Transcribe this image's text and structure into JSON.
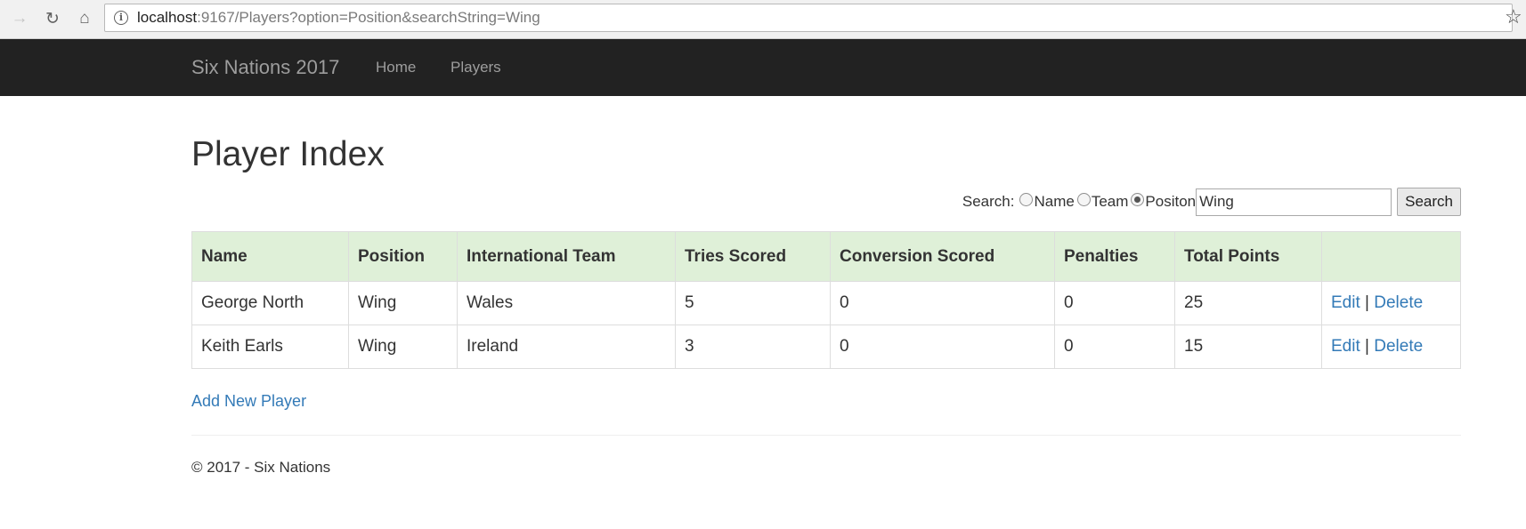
{
  "browser": {
    "url_host": "localhost",
    "url_rest": ":9167/Players?option=Position&searchString=Wing"
  },
  "navbar": {
    "brand": "Six Nations 2017",
    "links": [
      "Home",
      "Players"
    ]
  },
  "page": {
    "title": "Player Index"
  },
  "search": {
    "label": "Search:",
    "options": [
      {
        "label": "Name",
        "checked": false
      },
      {
        "label": "Team",
        "checked": false
      },
      {
        "label": "Positon",
        "checked": true
      }
    ],
    "value": "Wing",
    "button": "Search"
  },
  "table": {
    "headers": [
      "Name",
      "Position",
      "International Team",
      "Tries Scored",
      "Conversion Scored",
      "Penalties",
      "Total Points",
      ""
    ],
    "rows": [
      {
        "name": "George North",
        "position": "Wing",
        "team": "Wales",
        "tries": "5",
        "conversions": "0",
        "penalties": "0",
        "total": "25",
        "edit": "Edit",
        "sep": "|",
        "delete": "Delete"
      },
      {
        "name": "Keith Earls",
        "position": "Wing",
        "team": "Ireland",
        "tries": "3",
        "conversions": "0",
        "penalties": "0",
        "total": "15",
        "edit": "Edit",
        "sep": "|",
        "delete": "Delete"
      }
    ]
  },
  "add_link": "Add New Player",
  "footer": "© 2017 - Six Nations"
}
